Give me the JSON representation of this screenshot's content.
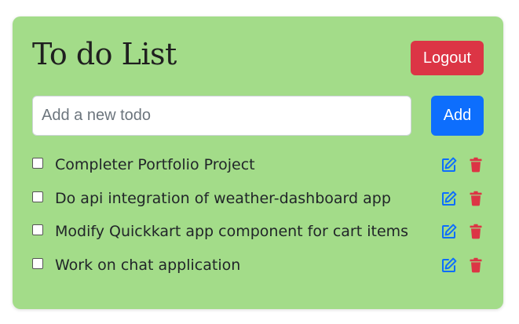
{
  "app": {
    "title": "To do List",
    "logout_label": "Logout"
  },
  "new_todo": {
    "value": "",
    "placeholder": "Add a new todo",
    "add_label": "Add"
  },
  "todos": [
    {
      "text": "Completer Portfolio Project",
      "completed": false
    },
    {
      "text": "Do api integration of weather-dashboard app",
      "completed": false
    },
    {
      "text": "Modify Quickkart app component for cart items",
      "completed": false
    },
    {
      "text": "Work on chat application",
      "completed": false
    }
  ],
  "icons": {
    "edit": "edit-icon",
    "delete": "trash-icon"
  },
  "colors": {
    "card_background": "#a3dc89",
    "logout": "#dc3545",
    "add": "#0d6efd",
    "edit_icon": "#0d6efd",
    "delete_icon": "#dc3545"
  }
}
